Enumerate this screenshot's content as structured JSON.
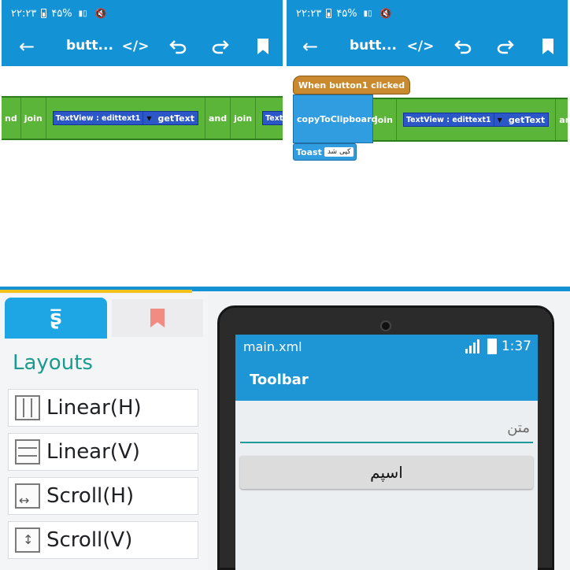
{
  "top_left": {
    "status": {
      "time": "۲۲:۲۳",
      "battery": "۴۵%"
    },
    "toolbar": {
      "title": "butt..."
    },
    "strip": [
      {
        "kind": "text",
        "label": "nd"
      },
      {
        "kind": "text",
        "label": "join"
      },
      {
        "kind": "textview",
        "selector": "TextView : edittext1",
        "method": "getText"
      },
      {
        "kind": "text",
        "label": "and"
      },
      {
        "kind": "text",
        "label": "join"
      },
      {
        "kind": "textview_cut",
        "selector": "TextView : edittext"
      }
    ]
  },
  "top_right": {
    "status": {
      "time": "۲۲:۲۳",
      "battery": "۴۵%"
    },
    "toolbar": {
      "title": "butt..."
    },
    "event_label": "When button1 clicked",
    "clipboard_label": "copyToClipboard",
    "strip": [
      {
        "kind": "text",
        "label": "join"
      },
      {
        "kind": "textview",
        "selector": "TextView : edittext1",
        "method": "getText"
      },
      {
        "kind": "text",
        "label": "and"
      },
      {
        "kind": "text",
        "label": "join"
      }
    ],
    "toast": {
      "label": "Toast",
      "text": "کپی شد"
    }
  },
  "palette": {
    "header": "Layouts",
    "items": [
      {
        "label": "Linear(H)",
        "icon": "linear-horizontal-icon"
      },
      {
        "label": "Linear(V)",
        "icon": "linear-vertical-icon"
      },
      {
        "label": "Scroll(H)",
        "icon": "scroll-horizontal-icon"
      },
      {
        "label": "Scroll(V)",
        "icon": "scroll-vertical-icon"
      }
    ]
  },
  "preview": {
    "file": "main.xml",
    "clock": "1:37",
    "toolbar_title": "Toolbar",
    "edittext_hint": "متن",
    "button_label": "اسپم"
  },
  "colors": {
    "app_blue": "#1492d6",
    "block_green": "#5bb538",
    "block_blue": "#2f9de0",
    "event_orange": "#c9892e",
    "palette_accent": "#1b9b8e"
  }
}
